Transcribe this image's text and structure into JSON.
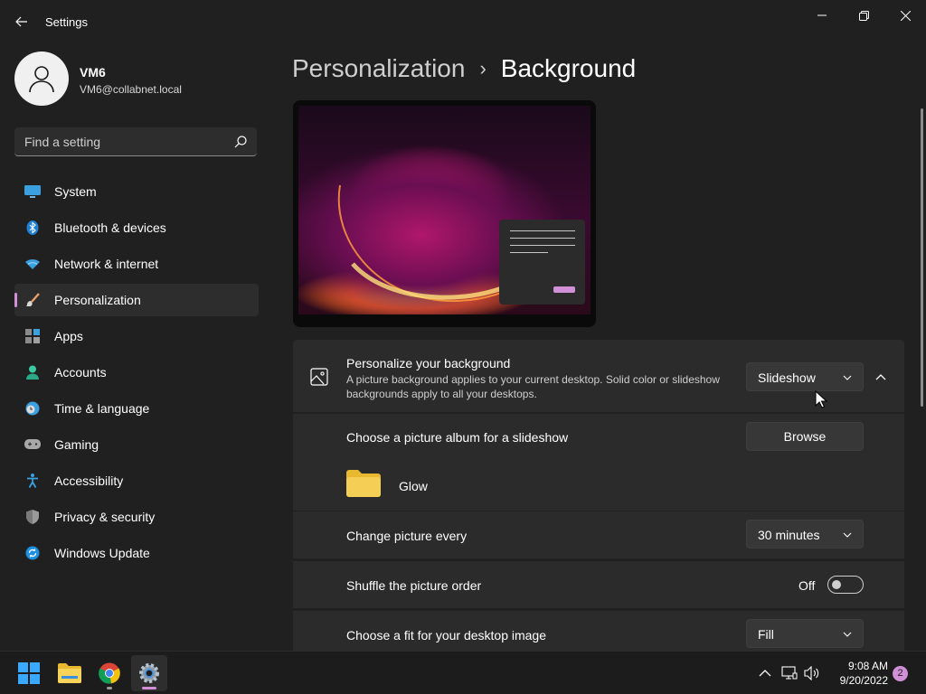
{
  "window": {
    "title": "Settings"
  },
  "profile": {
    "name": "VM6",
    "email": "VM6@collabnet.local"
  },
  "search": {
    "placeholder": "Find a setting"
  },
  "sidebar": {
    "items": [
      {
        "label": "System",
        "icon": "monitor-icon",
        "selected": false
      },
      {
        "label": "Bluetooth & devices",
        "icon": "bluetooth-icon",
        "selected": false
      },
      {
        "label": "Network & internet",
        "icon": "wifi-icon",
        "selected": false
      },
      {
        "label": "Personalization",
        "icon": "brush-icon",
        "selected": true
      },
      {
        "label": "Apps",
        "icon": "apps-icon",
        "selected": false
      },
      {
        "label": "Accounts",
        "icon": "person-icon",
        "selected": false
      },
      {
        "label": "Time & language",
        "icon": "globe-clock-icon",
        "selected": false
      },
      {
        "label": "Gaming",
        "icon": "gamepad-icon",
        "selected": false
      },
      {
        "label": "Accessibility",
        "icon": "accessibility-icon",
        "selected": false
      },
      {
        "label": "Privacy & security",
        "icon": "shield-icon",
        "selected": false
      },
      {
        "label": "Windows Update",
        "icon": "update-icon",
        "selected": false
      }
    ]
  },
  "breadcrumb": {
    "parent": "Personalization",
    "separator": "›",
    "current": "Background"
  },
  "personalize": {
    "title": "Personalize your background",
    "description": "A picture background applies to your current desktop. Solid color or slideshow backgrounds apply to all your desktops.",
    "selected": "Slideshow",
    "expanded": true
  },
  "album": {
    "label": "Choose a picture album for a slideshow",
    "browse_label": "Browse",
    "folder_name": "Glow"
  },
  "change_picture": {
    "label": "Change picture every",
    "selected": "30 minutes"
  },
  "shuffle": {
    "label": "Shuffle the picture order",
    "state": "Off"
  },
  "fit": {
    "label": "Choose a fit for your desktop image",
    "selected": "Fill"
  },
  "taskbar": {
    "apps": [
      "start-icon",
      "file-explorer-icon",
      "chrome-icon",
      "settings-icon"
    ],
    "time": "9:08 AM",
    "date": "9/20/2022",
    "notifications": "2"
  },
  "colors": {
    "accent": "#d08fd6",
    "background": "#202020",
    "card": "#2b2b2b"
  }
}
